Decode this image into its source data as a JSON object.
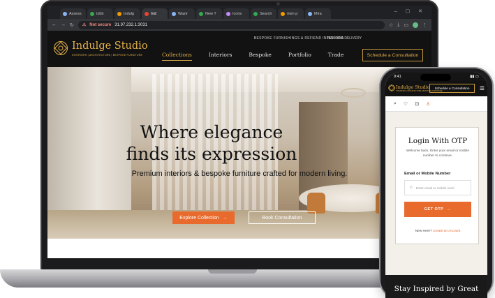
{
  "browser": {
    "tabs": [
      {
        "label": "Assess"
      },
      {
        "label": "Indulg"
      },
      {
        "label": "Ind"
      },
      {
        "label": "Wazir"
      },
      {
        "label": "New T"
      },
      {
        "label": "Icons"
      },
      {
        "label": "Search"
      },
      {
        "label": "men p"
      },
      {
        "label": "Mira"
      }
    ],
    "security_label": "Not secure",
    "url": "31.97.232.1:3031"
  },
  "site": {
    "topbar_left": "BESPOKE FURNISHINGS & REFIEND INTERIORS",
    "topbar_right": "PAN INDIA DELIVERY",
    "brand_name": "Indulge Studio",
    "brand_tagline": "INTERIORS | ARCHITECTURE | BESPOKE FURNITURE",
    "nav": [
      "Collections",
      "Interiors",
      "Bespoke",
      "Portfolio",
      "Trade"
    ],
    "cta": "Schedule a Consultation",
    "hero_title_line1": "Where elegance",
    "hero_title_line2": "finds its expression",
    "hero_sub": "Premium interiors  & bespoke furniture crafted for modern living.",
    "btn_explore": "Explore Collection",
    "btn_book": "Book Consultation"
  },
  "phone": {
    "time": "9:41",
    "brand_name": "Indulge Studio",
    "brand_tagline": "INTERIORS | ARCHITECTURE | BESPOKE FURNITURE",
    "cta": "Schedule a Consultation",
    "login_title": "Login With OTP",
    "login_desc": "Welcome back. Enter your email or mobile number to continue.",
    "login_label": "Email or Mobile Number",
    "login_placeholder": "Enter email or mobile numl",
    "login_btn": "GET OTP",
    "login_new_text": "New Here?",
    "login_new_link": "Create an Account",
    "footer_text": "Stay Inspired by Great"
  },
  "colors": {
    "brand_gold": "#e3b04b",
    "accent_orange": "#e86a2c",
    "header_dark": "#121212"
  }
}
